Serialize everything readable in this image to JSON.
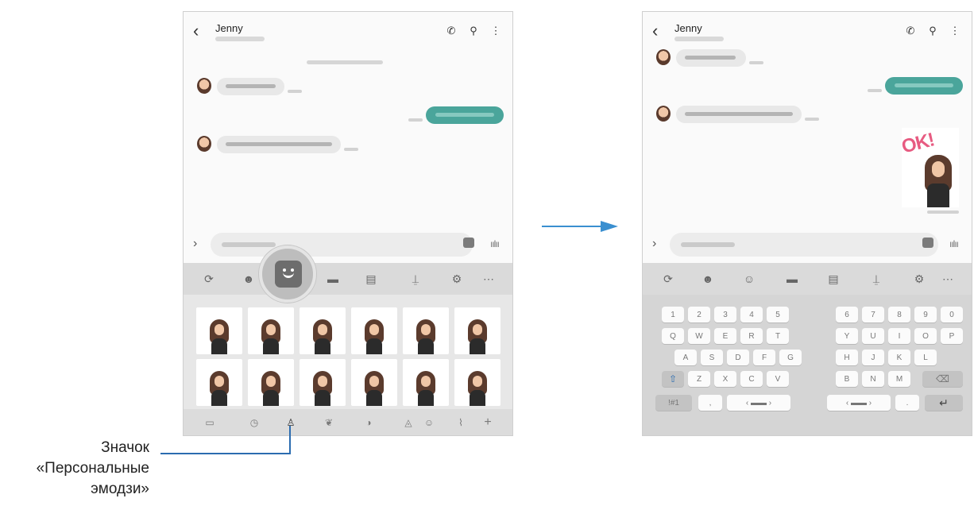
{
  "contact_name": "Jenny",
  "keys": {
    "row_num_left": [
      "1",
      "2",
      "3",
      "4",
      "5"
    ],
    "row_num_right": [
      "6",
      "7",
      "8",
      "9",
      "0"
    ],
    "row_q_left": [
      "Q",
      "W",
      "E",
      "R",
      "T"
    ],
    "row_q_right": [
      "Y",
      "U",
      "I",
      "O",
      "P"
    ],
    "row_a_left": [
      "A",
      "S",
      "D",
      "F",
      "G"
    ],
    "row_a_right": [
      "H",
      "J",
      "K",
      "L"
    ],
    "row_z_left": [
      "Z",
      "X",
      "C",
      "V"
    ],
    "row_z_right": [
      "B",
      "N",
      "M"
    ],
    "shift": "⇧",
    "delete": "⌫",
    "enter": "↵",
    "comma": ",",
    "period": ".",
    "symbols": "!#1"
  },
  "sticker_label": "OK!",
  "callout": {
    "line1": "Значок",
    "line2": "«Персональные",
    "line3": "эмодзи»"
  },
  "colors": {
    "accent_blue": "#2b6cb0",
    "outgoing_bubble": "#4aa59b",
    "sticker_text": "#e75b81"
  }
}
